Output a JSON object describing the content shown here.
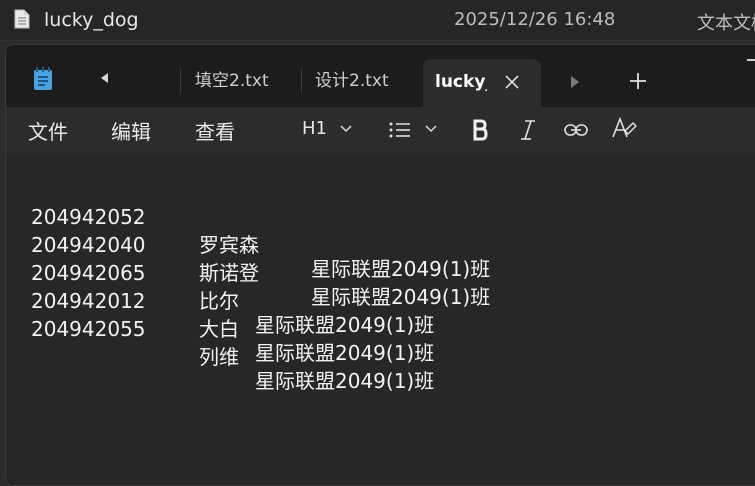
{
  "explorer": {
    "file_name": "lucky_dog",
    "modified": "2025/12/26 16:48",
    "type": "文本文档"
  },
  "tabs": [
    {
      "label": "填空2.txt"
    },
    {
      "label": "设计2.txt"
    },
    {
      "label": "lucky_dog.txt",
      "active": true
    }
  ],
  "menu": {
    "file": "文件",
    "edit": "编辑",
    "view": "查看"
  },
  "toolbar": {
    "heading": "H1",
    "icons": [
      "list-icon",
      "bold-icon",
      "italic-icon",
      "link-icon",
      "clear-format-icon"
    ]
  },
  "document": {
    "lines": [
      {
        "id": "204942052",
        "name": "罗宾森",
        "class": "星际联盟2049(1)班"
      },
      {
        "id": "204942040",
        "name": "斯诺登",
        "class": "星际联盟2049(1)班"
      },
      {
        "id": "204942065",
        "name": "比尔",
        "class": "星际联盟2049(1)班"
      },
      {
        "id": "204942012",
        "name": "大白",
        "class": "星际联盟2049(1)班"
      },
      {
        "id": "204942055",
        "name": "列维",
        "class": "星际联盟2049(1)班"
      }
    ]
  }
}
